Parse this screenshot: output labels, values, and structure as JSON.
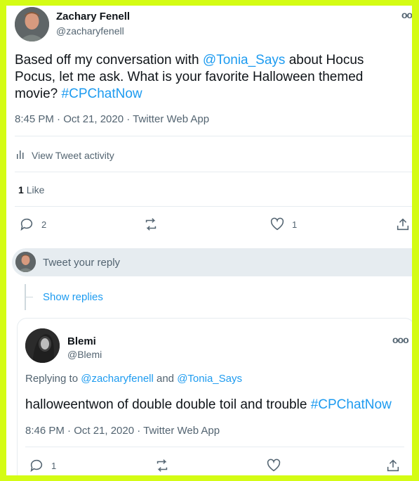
{
  "tweet": {
    "author_name": "Zachary Fenell",
    "author_handle": "@zacharyfenell",
    "text_part1": "Based off my conversation with ",
    "mention": "@Tonia_Says",
    "text_part2": " about Hocus Pocus, let me ask. What is your favorite Halloween themed movie? ",
    "hashtag": "#CPChatNow",
    "timestamp": "8:45 PM · Oct 21, 2020 · Twitter Web App",
    "activity_label": "View Tweet activity",
    "like_count": "1",
    "like_label": "Like",
    "reply_count": "2",
    "heart_count": "1",
    "more_icon": "more-dots-icon"
  },
  "reply_box": {
    "placeholder": "Tweet your reply"
  },
  "show_replies": "Show replies",
  "reply": {
    "author_name": "Blemi",
    "author_handle": "@Blemi",
    "replying_prefix": "Replying to ",
    "replying_user1": "@zacharyfenell",
    "replying_and": " and ",
    "replying_user2": "@Tonia_Says",
    "text_part1": "halloweentwon of double double toil and trouble ",
    "hashtag": "#CPChatNow",
    "timestamp": "8:46 PM · Oct 21, 2020 · Twitter Web App",
    "reply_count": "1"
  },
  "colors": {
    "accent": "#1d9bf0",
    "frame": "#d4fc14",
    "muted": "#536471"
  }
}
